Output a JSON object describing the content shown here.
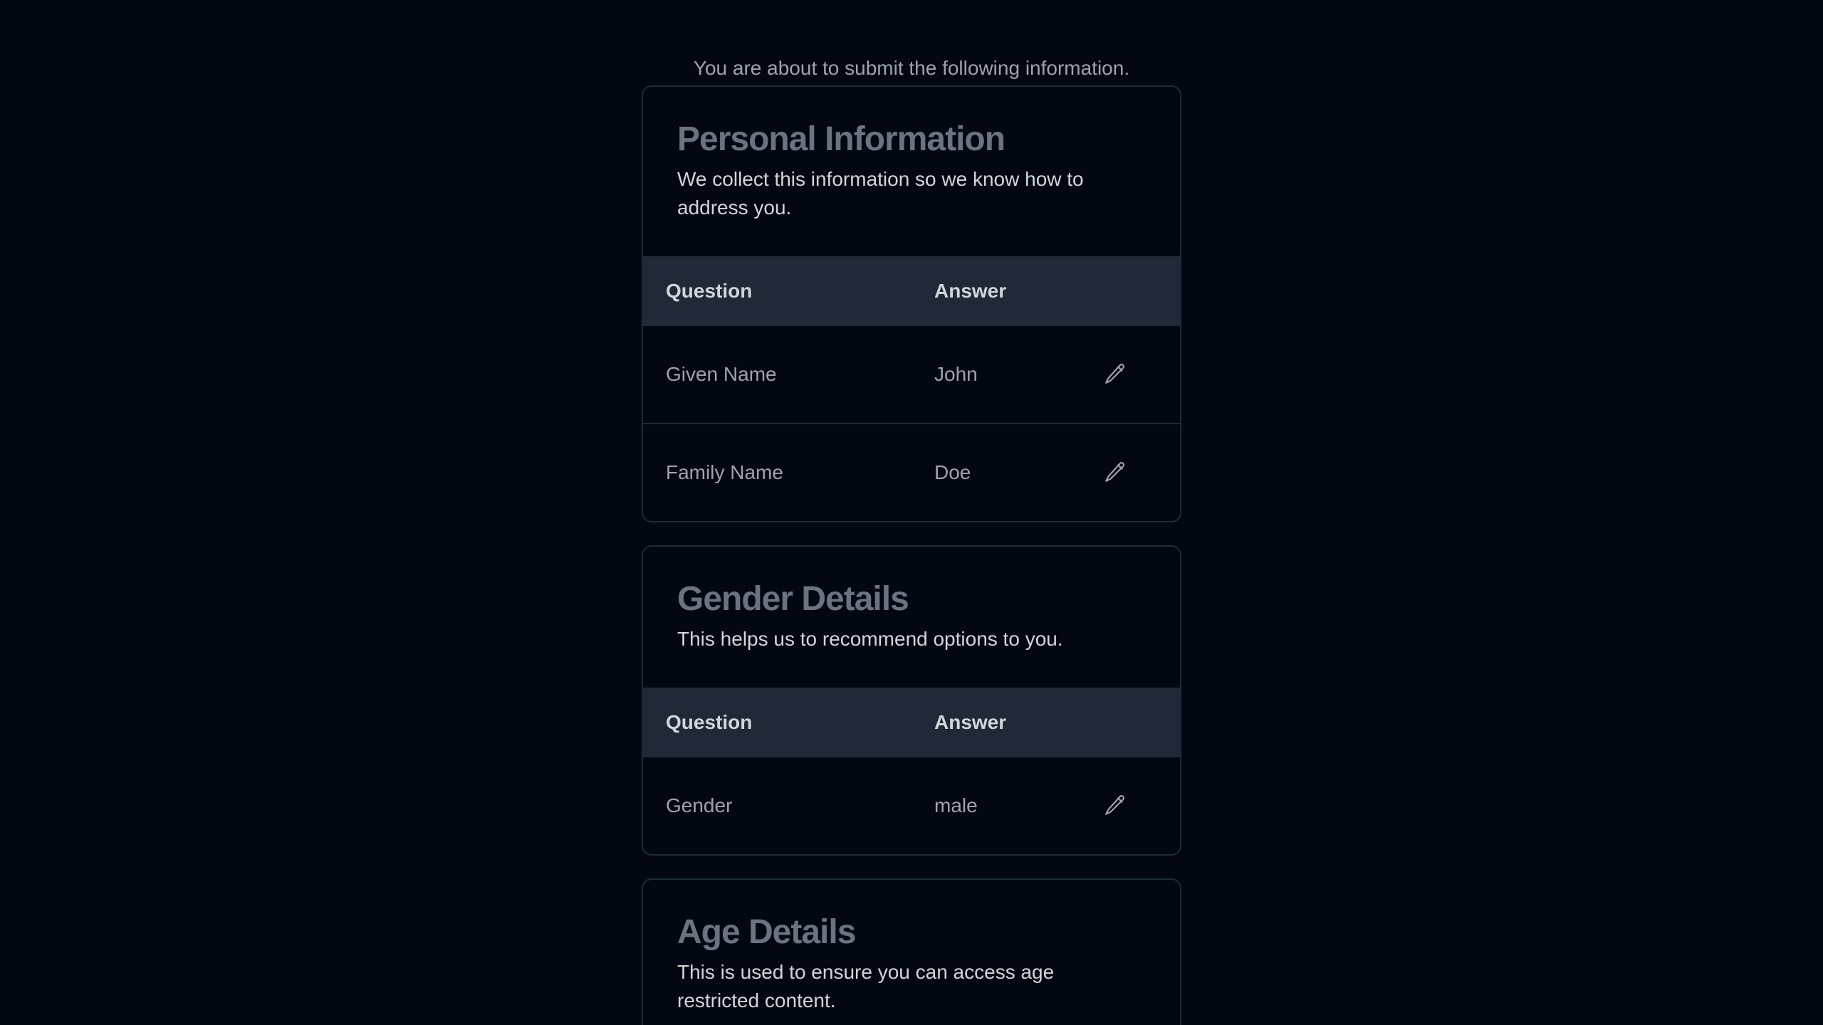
{
  "intro_text": "You are about to submit the following information.",
  "sections": {
    "personal": {
      "title": "Personal Information",
      "description": "We collect this information so we know how to address you.",
      "header_question": "Question",
      "header_answer": "Answer",
      "rows": [
        {
          "question": "Given Name",
          "answer": "John"
        },
        {
          "question": "Family Name",
          "answer": "Doe"
        }
      ]
    },
    "gender": {
      "title": "Gender Details",
      "description": "This helps us to recommend options to you.",
      "header_question": "Question",
      "header_answer": "Answer",
      "rows": [
        {
          "question": "Gender",
          "answer": "male"
        }
      ]
    },
    "age": {
      "title": "Age Details",
      "description": "This is used to ensure you can access age restricted content."
    }
  },
  "icons": {
    "edit": "pencil-icon"
  },
  "colors": {
    "background": "#030712",
    "card_border": "#1f2937",
    "table_header_bg": "#1f2937",
    "title_text": "#6b7280",
    "muted_text": "#9ca3af",
    "strong_text": "#d1d5db"
  }
}
